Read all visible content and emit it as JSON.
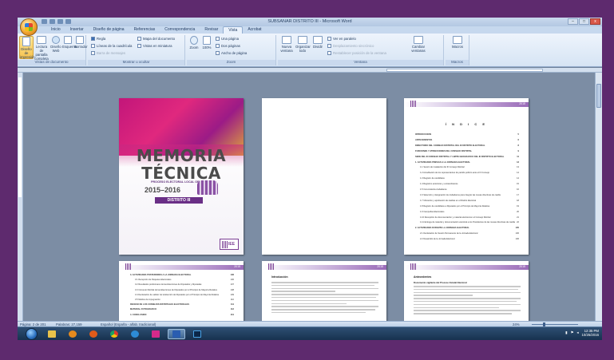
{
  "window": {
    "title": "SUBSANAR DISTRITO III - Microsoft Word",
    "controls": [
      "–",
      "□",
      "x"
    ]
  },
  "tabs": [
    "Inicio",
    "Insertar",
    "Diseño de página",
    "Referencias",
    "Correspondencia",
    "Revisar",
    "Vista",
    "Acrobat"
  ],
  "active_tab": "Vista",
  "ribbon": {
    "groups": {
      "views": "Vistas de documento",
      "showhide": "Mostrar u ocultar",
      "zoom": "Zoom",
      "window": "Ventana",
      "macros": "Macros"
    },
    "views_buttons": [
      "Diseño de impresión",
      "Lectura de pantalla completa",
      "Diseño Web",
      "Esquema",
      "Borrador"
    ],
    "showhide_checks": [
      "Regla",
      "Líneas de la cuadrícula",
      "Barra de mensajes",
      "Mapa del documento",
      "Vistas en miniatura"
    ],
    "zoom_buttons": [
      "Zoom",
      "100%",
      "Una página",
      "Dos páginas",
      "Ancho de página"
    ],
    "window_buttons": [
      "Nueva ventana",
      "Organizar todo",
      "Dividir"
    ],
    "window_checks": [
      "Ver en paralelo",
      "Desplazamiento sincrónico",
      "Restablecer posición de la ventana"
    ],
    "change_windows": "Cambiar ventanas",
    "macros_btn": "Macros"
  },
  "cover": {
    "title_line1": "MEMORIA",
    "title_line2": "TÉCNICA",
    "subtitle": "PROCESO ELECTORAL LOCAL ORDINARIO",
    "years": "2015–2016",
    "district": "DISTRITO III",
    "logo": "IEE"
  },
  "page_header_number": "2015",
  "index_page": {
    "title": "Í N D I C E",
    "entries": [
      {
        "t": "INTRODUCCIÓN",
        "n": "5",
        "b": true,
        "ind": false
      },
      {
        "t": "ANTECEDENTES",
        "n": "6",
        "b": true,
        "ind": false
      },
      {
        "t": "DIRECTORIO DEL CONSEJO DISTRITAL DEL III DISTRITO ELECTORAL",
        "n": "8",
        "b": true,
        "ind": false
      },
      {
        "t": "FUNCIONES Y ATRIBUCIONES DEL CONSEJO DISTRITAL",
        "n": "9",
        "b": true,
        "ind": false
      },
      {
        "t": "SEDE DEL III CONSEJO DISTRITAL Y LÍMITE GEOGRÁFICO DEL III DISTRITO ELECTORAL",
        "n": "11",
        "b": true,
        "ind": false
      },
      {
        "t": "1.  ACTIVIDADES PREVIAS A LA JORNADA ELECTORAL",
        "n": "13",
        "b": true,
        "ind": false
      },
      {
        "t": "1.1  Sesión de instalación del III Consejo Distrital",
        "n": "13",
        "b": false,
        "ind": true
      },
      {
        "t": "1.2  Acreditación de los representantes de partido político ante el III Consejo",
        "n": "14",
        "b": false,
        "ind": true
      },
      {
        "t": "1.3  Registro de candidatos",
        "n": "14",
        "b": false,
        "ind": true
      },
      {
        "t": "1.4  Registros anteriores y extraordinarios",
        "n": "15",
        "b": false,
        "ind": true
      },
      {
        "t": "1.5  Convocatoria ciudadanos",
        "n": "16",
        "b": false,
        "ind": true
      },
      {
        "t": "1.6  Selección y designación de ciudadanos para integrar las mesas directivas de casilla",
        "n": "17",
        "b": false,
        "ind": true
      },
      {
        "t": "1.7  Ubicación y aprobación de casillas en el Distrito Electoral",
        "n": "18",
        "b": false,
        "ind": true
      },
      {
        "t": "1.8  Registro de candidatos a Diputados por el Principio de Mayoría Relativa",
        "n": "19",
        "b": false,
        "ind": true
      },
      {
        "t": "1.9  Campañas Electorales",
        "n": "20",
        "b": false,
        "ind": true
      },
      {
        "t": "1.10 Recepción de documentación y material electoral en el Consejo Distrital",
        "n": "21",
        "b": false,
        "ind": true
      },
      {
        "t": "1.11 Entrega de material y documentación electoral a los Presidentes de las mesas directivas de casilla",
        "n": "22",
        "b": false,
        "ind": true
      },
      {
        "t": "2.  ACTIVIDADES DURANTE LA JORNADA ELECTORAL",
        "n": "105",
        "b": true,
        "ind": false
      },
      {
        "t": "2.1  Declaración de Sesión Permanente de la Jornada Electoral",
        "n": "106",
        "b": false,
        "ind": true
      },
      {
        "t": "2.2  Desarrollo de la Jornada Electoral",
        "n": "106",
        "b": false,
        "ind": true
      }
    ]
  },
  "index_cont": {
    "entries": [
      {
        "t": "3.  ACTIVIDADES POSTERIORES A LA JORNADA ELECTORAL",
        "n": "106",
        "b": true,
        "ind": false
      },
      {
        "t": "3.1  Recepción de Paquetes Electorales",
        "n": "106",
        "b": false,
        "ind": true
      },
      {
        "t": "3.2  Resultados preliminares de las Elecciones de Diputados y Diputadas",
        "n": "107",
        "b": false,
        "ind": true
      },
      {
        "t": "3.3  Cómputo Distrital de las Elecciones de Diputados por el Principio de Mayoría Relativa",
        "n": "108",
        "b": false,
        "ind": true
      },
      {
        "t": "3.4  Declaración de validez de la Elección de Diputados por el Principio de Mayoría Relativa",
        "n": "109",
        "b": false,
        "ind": true
      },
      {
        "t": "3.5  Medios de impugnación",
        "n": "110",
        "b": false,
        "ind": true
      },
      {
        "t": "RECESO DE LOS CONSEJOS DISTRITALES ELECTORALES",
        "n": "111",
        "b": true,
        "ind": false
      },
      {
        "t": "MATERIAL FOTOGRÁFICO",
        "n": "112",
        "b": true,
        "ind": false
      },
      {
        "t": "4.  CONCLUSIÓN",
        "n": "211",
        "b": true,
        "ind": false
      }
    ]
  },
  "intro_page": {
    "heading": "Introducción"
  },
  "antecedentes_page": {
    "heading": "Antecedentes",
    "subheading": "Documento vigilante del Proceso Estatal Electoral"
  },
  "status": {
    "page": "Página: 2 de 201",
    "words": "Palabras: 27,159",
    "lang": "Español (España - alfab. tradicional)",
    "zoom": "24%"
  },
  "taskbar": {
    "time": "12:35 PM",
    "date": "10/25/2016"
  }
}
